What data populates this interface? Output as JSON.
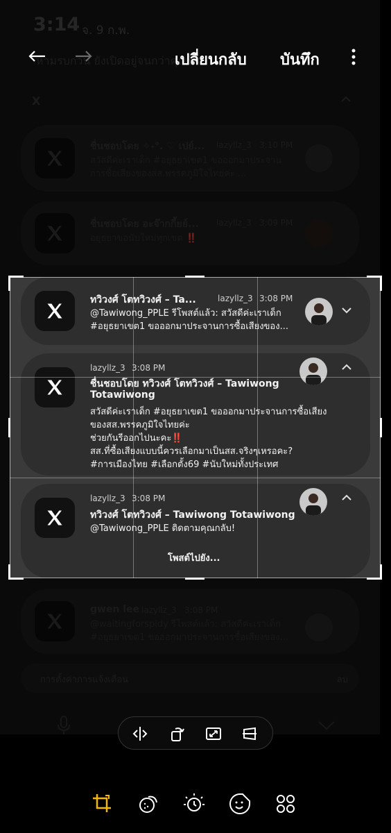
{
  "status": {
    "time": "3:14",
    "date": "จ. 9 ก.พ."
  },
  "topbar": {
    "revert_label": "เปลี่ยนกลับ",
    "save_label": "บันทึก"
  },
  "background": {
    "subheader": "ห้ามรบกวน ยังเปิดอยู่จนกว่าคุณปิด",
    "x_header": "X",
    "notif1": {
      "title": "ชื่นชอบโดย ✧˖°. ♡ เปย์...",
      "user": "lazyllz_3",
      "time": "3:10 PM",
      "line1": "สวัสดีค่ะเราเด็ก #อยุธยาเขต1  ขอออกมาประจาน",
      "line2": "การซื้อเสียงของสส.พรรคภูมิใจไทยค่ะ  ..."
    },
    "notif2": {
      "title": "ชื่นชอบโดย อะจ๊ากกี้ยย์...",
      "user": "lazyllz_3",
      "time": "3:09 PM",
      "line1": "อยุธยาขอนับใหม่ทุกเขต ‼️"
    },
    "notif_gwen": {
      "title": "gwen lee",
      "user": "lazyllz_3",
      "time": "3:08 PM",
      "line1": "@waitingforspidy รีโพสต์แล้ว: สวัสดีค่ะเราเด็ก",
      "line2": "#อยุธยาเขต1  ขอออกมาประจานการซื้อเสียงของ..."
    },
    "settings_label": "การตั้งค่าการแจ้งเตือน",
    "delete_label": "ลบ"
  },
  "crop": {
    "card1": {
      "title": "ทวิวงศ์ โตทวิวงศ์ – Ta...",
      "user": "lazyllz_3",
      "time": "3:08 PM",
      "line1": "@Tawiwong_PPLE รีโพสต์แล้ว: สวัสดีค่ะเราเด็ก",
      "line2": "#อยุธยาเขต1  ขอออกมาประจานการซื้อเสียงของ..."
    },
    "card2": {
      "user": "lazyllz_3",
      "time": "3:08 PM",
      "title1": "ชื่นชอบโดย ทวิวงศ์ โตทวิวงศ์ – Tawiwong",
      "title2": "Totawiwong",
      "line1": "สวัสดีค่ะเราเด็ก #อยุธยาเขต1  ขอออกมาประจานการซื้อเสียง",
      "line2": "ของสส.พรรคภูมิใจไทยค่ะ",
      "line3": "ช่วยกันรีออกไปนะคะ‼️",
      "line4": "สส.ที่ซื้อเสียงแบบนี้ควรเลือกมาเป็นสส.จริงๆเหรอคะ?",
      "line5": "#การเมืองไทย #เลือกตั้ง69 #นับใหม่ทั้งประเทศ"
    },
    "card3": {
      "user": "lazyllz_3",
      "time": "3:08 PM",
      "title": "ทวิวงศ์ โตทวิวงศ์ – Tawiwong Totawiwong",
      "line1": "@Tawiwong_PPLE ติดตามคุณกลับ!",
      "action": "โพสต์ไปยัง..."
    }
  },
  "colors": {
    "accent": "#f5b800"
  }
}
